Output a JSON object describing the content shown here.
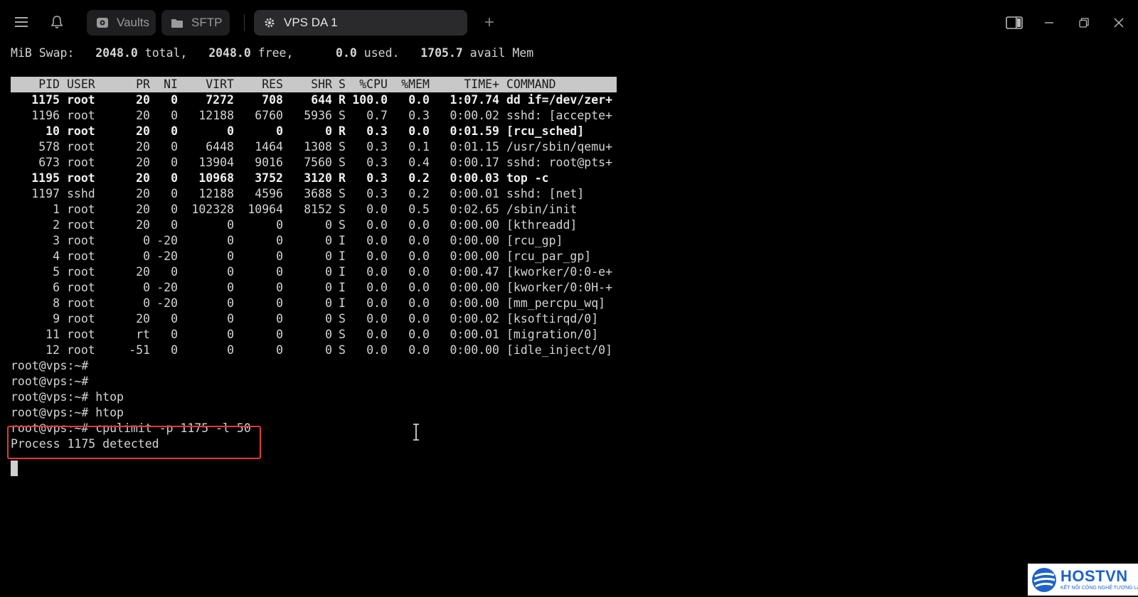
{
  "titlebar": {
    "tabs": [
      {
        "label": "Vaults",
        "icon": "vault-icon"
      },
      {
        "label": "SFTP",
        "icon": "folder-icon"
      },
      {
        "label": "VPS DA 1",
        "icon": "gear-icon",
        "active": true
      }
    ],
    "new_tab_icon": "plus-icon",
    "menu_icon": "hamburger-menu-icon",
    "notification_icon": "bell-icon",
    "window_controls": [
      "split-panel-icon",
      "minimize-icon",
      "restore-icon",
      "close-icon"
    ]
  },
  "terminal": {
    "swap": {
      "prefix": "MiB Swap:",
      "total": "2048.0",
      "total_label": "total,",
      "free": "2048.0",
      "free_label": "free,",
      "used": "0.0",
      "used_label": "used.",
      "avail": "1705.7",
      "avail_label": "avail Mem"
    },
    "columns": [
      "PID",
      "USER",
      "PR",
      "NI",
      "VIRT",
      "RES",
      "SHR",
      "S",
      "%CPU",
      "%MEM",
      "TIME+",
      "COMMAND"
    ],
    "processes": [
      {
        "pid": "1175",
        "user": "root",
        "pr": "20",
        "ni": "0",
        "virt": "7272",
        "res": "708",
        "shr": "644",
        "s": "R",
        "cpu": "100.0",
        "mem": "0.0",
        "time": "1:07.74",
        "cmd": "dd if=/dev/zer+",
        "bold": true
      },
      {
        "pid": "1196",
        "user": "root",
        "pr": "20",
        "ni": "0",
        "virt": "12188",
        "res": "6760",
        "shr": "5936",
        "s": "S",
        "cpu": "0.7",
        "mem": "0.3",
        "time": "0:00.02",
        "cmd": "sshd: [accepte+",
        "bold": false
      },
      {
        "pid": "10",
        "user": "root",
        "pr": "20",
        "ni": "0",
        "virt": "0",
        "res": "0",
        "shr": "0",
        "s": "R",
        "cpu": "0.3",
        "mem": "0.0",
        "time": "0:01.59",
        "cmd": "[rcu_sched]",
        "bold": true
      },
      {
        "pid": "578",
        "user": "root",
        "pr": "20",
        "ni": "0",
        "virt": "6448",
        "res": "1464",
        "shr": "1308",
        "s": "S",
        "cpu": "0.3",
        "mem": "0.1",
        "time": "0:01.15",
        "cmd": "/usr/sbin/qemu+",
        "bold": false
      },
      {
        "pid": "673",
        "user": "root",
        "pr": "20",
        "ni": "0",
        "virt": "13904",
        "res": "9016",
        "shr": "7560",
        "s": "S",
        "cpu": "0.3",
        "mem": "0.4",
        "time": "0:00.17",
        "cmd": "sshd: root@pts+",
        "bold": false
      },
      {
        "pid": "1195",
        "user": "root",
        "pr": "20",
        "ni": "0",
        "virt": "10968",
        "res": "3752",
        "shr": "3120",
        "s": "R",
        "cpu": "0.3",
        "mem": "0.2",
        "time": "0:00.03",
        "cmd": "top -c",
        "bold": true
      },
      {
        "pid": "1197",
        "user": "sshd",
        "pr": "20",
        "ni": "0",
        "virt": "12188",
        "res": "4596",
        "shr": "3688",
        "s": "S",
        "cpu": "0.3",
        "mem": "0.2",
        "time": "0:00.01",
        "cmd": "sshd: [net]",
        "bold": false
      },
      {
        "pid": "1",
        "user": "root",
        "pr": "20",
        "ni": "0",
        "virt": "102328",
        "res": "10964",
        "shr": "8152",
        "s": "S",
        "cpu": "0.0",
        "mem": "0.5",
        "time": "0:02.65",
        "cmd": "/sbin/init",
        "bold": false
      },
      {
        "pid": "2",
        "user": "root",
        "pr": "20",
        "ni": "0",
        "virt": "0",
        "res": "0",
        "shr": "0",
        "s": "S",
        "cpu": "0.0",
        "mem": "0.0",
        "time": "0:00.00",
        "cmd": "[kthreadd]",
        "bold": false
      },
      {
        "pid": "3",
        "user": "root",
        "pr": "0",
        "ni": "-20",
        "virt": "0",
        "res": "0",
        "shr": "0",
        "s": "I",
        "cpu": "0.0",
        "mem": "0.0",
        "time": "0:00.00",
        "cmd": "[rcu_gp]",
        "bold": false
      },
      {
        "pid": "4",
        "user": "root",
        "pr": "0",
        "ni": "-20",
        "virt": "0",
        "res": "0",
        "shr": "0",
        "s": "I",
        "cpu": "0.0",
        "mem": "0.0",
        "time": "0:00.00",
        "cmd": "[rcu_par_gp]",
        "bold": false
      },
      {
        "pid": "5",
        "user": "root",
        "pr": "20",
        "ni": "0",
        "virt": "0",
        "res": "0",
        "shr": "0",
        "s": "I",
        "cpu": "0.0",
        "mem": "0.0",
        "time": "0:00.47",
        "cmd": "[kworker/0:0-e+",
        "bold": false
      },
      {
        "pid": "6",
        "user": "root",
        "pr": "0",
        "ni": "-20",
        "virt": "0",
        "res": "0",
        "shr": "0",
        "s": "I",
        "cpu": "0.0",
        "mem": "0.0",
        "time": "0:00.00",
        "cmd": "[kworker/0:0H-+",
        "bold": false
      },
      {
        "pid": "8",
        "user": "root",
        "pr": "0",
        "ni": "-20",
        "virt": "0",
        "res": "0",
        "shr": "0",
        "s": "I",
        "cpu": "0.0",
        "mem": "0.0",
        "time": "0:00.00",
        "cmd": "[mm_percpu_wq]",
        "bold": false
      },
      {
        "pid": "9",
        "user": "root",
        "pr": "20",
        "ni": "0",
        "virt": "0",
        "res": "0",
        "shr": "0",
        "s": "S",
        "cpu": "0.0",
        "mem": "0.0",
        "time": "0:00.02",
        "cmd": "[ksoftirqd/0]",
        "bold": false
      },
      {
        "pid": "11",
        "user": "root",
        "pr": "rt",
        "ni": "0",
        "virt": "0",
        "res": "0",
        "shr": "0",
        "s": "S",
        "cpu": "0.0",
        "mem": "0.0",
        "time": "0:00.01",
        "cmd": "[migration/0]",
        "bold": false
      },
      {
        "pid": "12",
        "user": "root",
        "pr": "-51",
        "ni": "0",
        "virt": "0",
        "res": "0",
        "shr": "0",
        "s": "S",
        "cpu": "0.0",
        "mem": "0.0",
        "time": "0:00.00",
        "cmd": "[idle_inject/0]",
        "bold": false
      }
    ],
    "prompt_lines": [
      "root@vps:~#",
      "root@vps:~#",
      "root@vps:~# htop",
      "root@vps:~# htop",
      "root@vps:~# cpulimit -p 1175 -l 50",
      "Process 1175 detected"
    ]
  },
  "watermark": {
    "name": "HOSTVN",
    "tagline": "KẾT NỐI CÔNG NGHỆ TƯƠNG LAI"
  },
  "colors": {
    "background": "#000000",
    "highlight_box": "#e0393b",
    "header_bar": "#c8c8c8",
    "brand_blue": "#1e63c8"
  }
}
